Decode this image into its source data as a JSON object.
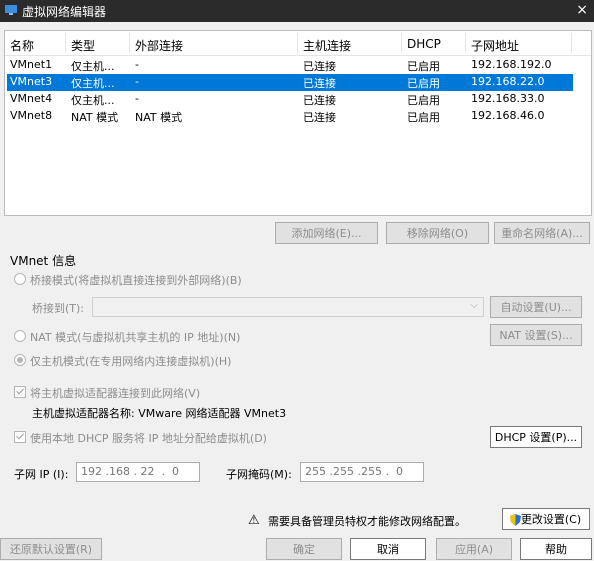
{
  "window": {
    "title": "虚拟网络编辑器",
    "close": "×"
  },
  "table": {
    "headers": [
      "名称",
      "类型",
      "外部连接",
      "主机连接",
      "DHCP",
      "子网地址"
    ],
    "rows": [
      {
        "name": "VMnet1",
        "type": "仅主机...",
        "external": "-",
        "host": "已连接",
        "dhcp": "已启用",
        "subnet": "192.168.192.0",
        "selected": false
      },
      {
        "name": "VMnet3",
        "type": "仅主机...",
        "external": "-",
        "host": "已连接",
        "dhcp": "已启用",
        "subnet": "192.168.22.0",
        "selected": true
      },
      {
        "name": "VMnet4",
        "type": "仅主机...",
        "external": "-",
        "host": "已连接",
        "dhcp": "已启用",
        "subnet": "192.168.33.0",
        "selected": false
      },
      {
        "name": "VMnet8",
        "type": "NAT 模式",
        "external": "NAT 模式",
        "host": "已连接",
        "dhcp": "已启用",
        "subnet": "192.168.46.0",
        "selected": false
      }
    ]
  },
  "table_buttons": {
    "add": "添加网络(E)...",
    "remove": "移除网络(O)",
    "rename": "重命名网络(A)..."
  },
  "vmnet_info": {
    "title": "VMnet 信息",
    "bridged": "桥接模式(将虚拟机直接连接到外部网络)(B)",
    "bridged_to": "桥接到(T):",
    "auto_settings": "自动设置(U)...",
    "nat": "NAT 模式(与虚拟机共享主机的 IP 地址)(N)",
    "nat_settings": "NAT 设置(S)...",
    "host_only": "仅主机模式(在专用网络内连接虚拟机)(H)",
    "connect_adapter": "将主机虚拟适配器连接到此网络(V)",
    "adapter_name": "主机虚拟适配器名称: VMware 网络适配器 VMnet3",
    "use_dhcp": "使用本地 DHCP 服务将 IP 地址分配给虚拟机(D)",
    "dhcp_settings": "DHCP 设置(P)...",
    "subnet_ip_label": "子网 IP (I):",
    "subnet_ip": "192 .168 . 22  .  0",
    "subnet_mask_label": "子网掩码(M):",
    "subnet_mask": "255 .255 .255 .  0"
  },
  "footer": {
    "warning_icon": "⚠",
    "warning": "需要具备管理员特权才能修改网络配置。",
    "change_settings": "更改设置(C)",
    "restore": "还原默认设置(R)",
    "ok": "确定",
    "cancel": "取消",
    "apply": "应用(A)",
    "help": "帮助"
  },
  "colors": {
    "selection": "#0078d7",
    "titlebar": "#2b2b2b"
  }
}
